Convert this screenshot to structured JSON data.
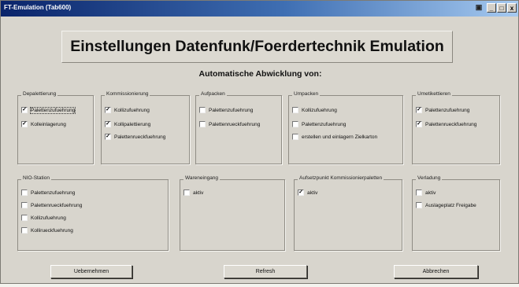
{
  "window": {
    "title": "FT-Emulation (Tab600)",
    "app_icon": "window-app-icon",
    "controls": {
      "minimize": "_",
      "maximize": "□",
      "close": "x"
    }
  },
  "header": {
    "title": "Einstellungen Datenfunk/Foerdertechnik Emulation",
    "subtitle": "Automatische Abwicklung von:"
  },
  "groups": {
    "depalettierung": {
      "label": "Depalettierung",
      "items": [
        {
          "label": "Palettenzufuehrung",
          "checked": true
        },
        {
          "label": "Kolleinlagerung",
          "checked": true
        }
      ]
    },
    "kommissionierung": {
      "label": "Kommissionierung",
      "items": [
        {
          "label": "Kollizufuehrung",
          "checked": true
        },
        {
          "label": "Kollipalettierung",
          "checked": true
        },
        {
          "label": "Palettenrueckfuehrung",
          "checked": true
        }
      ]
    },
    "aufpacken": {
      "label": "Aufpacken",
      "items": [
        {
          "label": "Palettenzufuehrung",
          "checked": false
        },
        {
          "label": "Palettenrueckfuehrung",
          "checked": false
        }
      ]
    },
    "umpacken": {
      "label": "Umpacken",
      "items": [
        {
          "label": "Kollizufuehrung",
          "checked": false
        },
        {
          "label": "Palettenzufuehrung",
          "checked": false
        },
        {
          "label": "erstellen und einlagern Zielkarton",
          "checked": false
        }
      ]
    },
    "umetikettieren": {
      "label": "Umetikettieren",
      "items": [
        {
          "label": "Palettenzufuehrung",
          "checked": true
        },
        {
          "label": "Palettenrueckfuehrung",
          "checked": true
        }
      ]
    },
    "nio_station": {
      "label": "NIO-Station",
      "items": [
        {
          "label": "Palettenzufuehrung",
          "checked": false
        },
        {
          "label": "Palettenrueckfuehrung",
          "checked": false
        },
        {
          "label": "Kollizufuehrung",
          "checked": false
        },
        {
          "label": "Kollirueckfuehrung",
          "checked": false
        }
      ]
    },
    "wareneingang": {
      "label": "Wareneingang",
      "items": [
        {
          "label": "aktiv",
          "checked": false
        }
      ]
    },
    "aufsetzpunkt": {
      "label": "Aufsetzpunkt Kommissionierpaletten",
      "items": [
        {
          "label": "aktiv",
          "checked": true
        }
      ]
    },
    "verladung": {
      "label": "Verladung",
      "items": [
        {
          "label": "aktiv",
          "checked": false
        },
        {
          "label": "Auslageplatz Freigabe",
          "checked": false
        }
      ]
    }
  },
  "buttons": {
    "uebernehmen": "Uebernehmen",
    "refresh": "Refresh",
    "abbrechen": "Abbrechen"
  }
}
